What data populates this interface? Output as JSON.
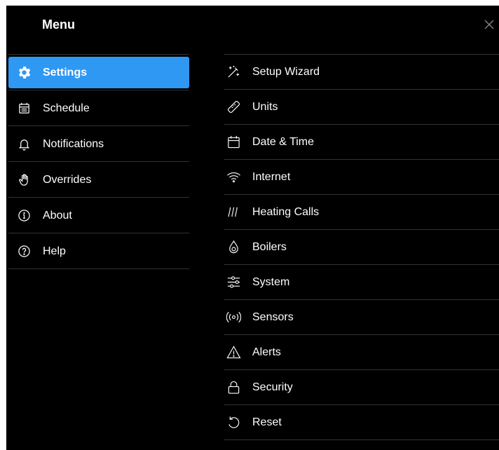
{
  "menu": {
    "title": "Menu"
  },
  "colors": {
    "background": "#000000",
    "accent": "#2f98f3",
    "separator": "#333333",
    "text": "#ffffff"
  },
  "sidebar": {
    "items": [
      {
        "label": "Settings",
        "icon": "gear-icon",
        "active": true
      },
      {
        "label": "Schedule",
        "icon": "calendar-icon"
      },
      {
        "label": "Notifications",
        "icon": "bell-icon"
      },
      {
        "label": "Overrides",
        "icon": "hand-icon"
      },
      {
        "label": "About",
        "icon": "info-icon"
      },
      {
        "label": "Help",
        "icon": "help-icon"
      }
    ]
  },
  "settings": {
    "items": [
      {
        "label": "Setup Wizard",
        "icon": "magic-wand-icon"
      },
      {
        "label": "Units",
        "icon": "ruler-icon"
      },
      {
        "label": "Date & Time",
        "icon": "calendar-icon"
      },
      {
        "label": "Internet",
        "icon": "wifi-icon"
      },
      {
        "label": "Heating Calls",
        "icon": "heat-icon"
      },
      {
        "label": "Boilers",
        "icon": "flame-icon"
      },
      {
        "label": "System",
        "icon": "sliders-icon"
      },
      {
        "label": "Sensors",
        "icon": "sensor-icon"
      },
      {
        "label": "Alerts",
        "icon": "alert-icon"
      },
      {
        "label": "Security",
        "icon": "lock-icon"
      },
      {
        "label": "Reset",
        "icon": "reset-icon"
      }
    ]
  }
}
